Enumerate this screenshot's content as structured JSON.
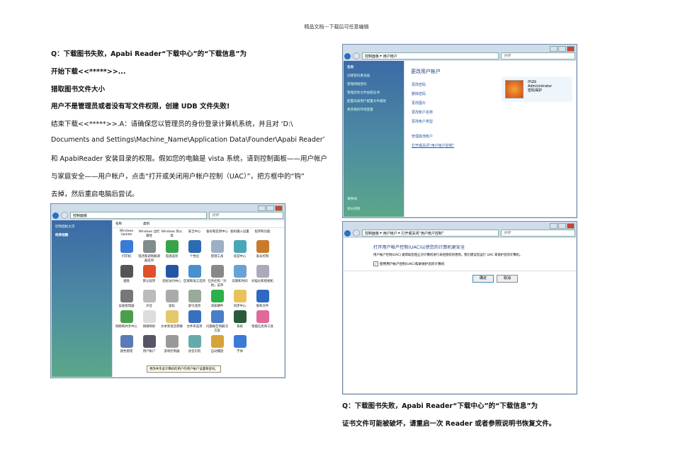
{
  "header": "精品文档---下载后可任意编辑",
  "left_text": [
    "Q：下载图书失败，Apabi Reader“下载中心”的“下载信息”为",
    "开始下载<<*****>>...",
    "猎取图书文件大小",
    "用户不是管理员或者没有写文件权限，创建 UDB 文件失败!",
    "结束下载<<*****>>.A：请确保您以管理员的身份登录计算机系统，并且对 ‘D:\\",
    "Documents and Settings\\Machine_Name\\Application Data\\Founder\\Apabi Reader’",
    "和 ApabiReader 安装目录的权限。假如您的电脑是 vista 系统，请到控制面板——用户帐户",
    "与家庭安全——用户帐户，点击“打开或关闭用户帐户控制（UAC）”，把方框中的“钩”",
    "去掉，然后重启电脑后尝试。"
  ],
  "right_text": [
    "Q：下载图书失败，Apabi Reader“下载中心”的“下载信息”为",
    "证书文件可能被破坏，请重启一次 Reader 或者参照说明书恢复文件。"
  ],
  "cp": {
    "path": "控制面板",
    "search": "搜索",
    "side": [
      "控制面板主页",
      "经典视图"
    ],
    "cols": [
      "名称",
      "类别"
    ],
    "items": [
      "Windows Update",
      "Windows 边栏属性",
      "Windows 防火墙",
      "安全中心",
      "备份和还原中心",
      "脱机输入设置",
      "程序和功能",
      "打印机",
      "电话和调制解调器选项",
      "电源选项",
      "个性化",
      "管理工具",
      "欢迎中心",
      "家长控制",
      "键盘",
      "默认程序",
      "轻松访问中心",
      "区域和语言选项",
      "任务栏和「开始」菜单",
      "日期和时间",
      "扫描仪和照相机",
      "设备管理器",
      "声音",
      "鼠标",
      "索引选项",
      "添加硬件",
      "同步中心",
      "脱机文件",
      "网络和共享中心",
      "网络映射",
      "文本到语音转换",
      "文件夹选项",
      "问题报告和解决方案",
      "系统",
      "性能信息和工具",
      "颜色管理",
      "用户帐户",
      "游戏控制器",
      "语音识别",
      "自动播放",
      "字体"
    ],
    "tooltip": "更改共享此计算机的用户的用户帐户设置和密码。"
  },
  "ua": {
    "path": [
      "控制面板",
      "用户帐户"
    ],
    "search": "搜索",
    "side": [
      "任务",
      "创建密码重设盘",
      "管理网络密码",
      "管理您的文件加密证书",
      "配置高级用户配置文件属性",
      "更改我的环境变量"
    ],
    "see_also": "请参阅",
    "parental": "家长控制",
    "title": "更改用户帐户",
    "links": [
      "更改密码",
      "删除密码",
      "更改图片",
      "更改帐户名称",
      "更改帐户类型",
      "管理其他帐户",
      "打开或关闭“用户帐户控制”"
    ],
    "user": {
      "name": "mzs",
      "role": "Administrator",
      "status": "密码保护"
    }
  },
  "uac": {
    "path": [
      "控制面板",
      "用户帐户",
      "打开或关闭“用户帐户控制”"
    ],
    "search": "搜索",
    "title": "打开用户帐户控制(UAC)以使您的计算机更安全",
    "desc": "用户帐户控制(UAC) 能帮助您阻止对计算机进行未经授权的更改。我们建议您运行 UAC 来保护您的计算机。",
    "checkbox": "使用用户帐户控制(UAC)帮助保护您的计算机",
    "checked": true,
    "ok": "确定",
    "cancel": "取消"
  }
}
